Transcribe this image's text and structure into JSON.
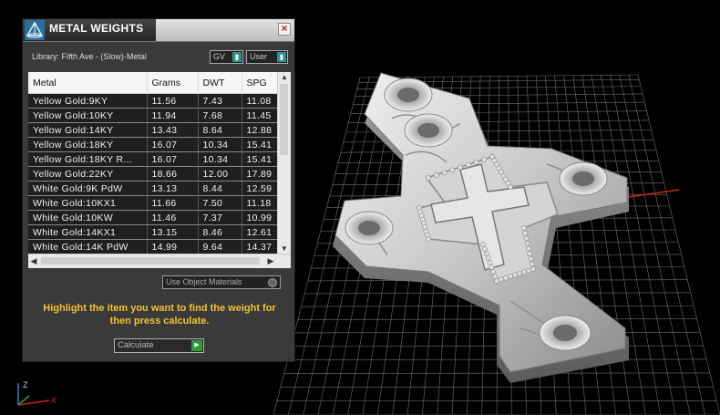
{
  "panel": {
    "title": "METAL WEIGHTS",
    "close_label": "×",
    "library_label": "Library: Fifth Ave - (Slow)-Metal",
    "gv_combo": "GV",
    "user_combo": "User",
    "combo_arrow": "▮",
    "use_object_materials": "Use Object Materials",
    "instruction": "Highlight the item you want to find the weight for then press calculate.",
    "calculate_label": "Calculate",
    "calculate_icon": "▶"
  },
  "table": {
    "columns": [
      "Metal",
      "Grams",
      "DWT",
      "SPG"
    ],
    "rows": [
      [
        "Yellow Gold:9KY",
        "11.56",
        "7.43",
        "11.08"
      ],
      [
        "Yellow Gold:10KY",
        "11.94",
        "7.68",
        "11.45"
      ],
      [
        "Yellow Gold:14KY",
        "13.43",
        "8.64",
        "12.88"
      ],
      [
        "Yellow Gold:18KY",
        "16.07",
        "10.34",
        "15.41"
      ],
      [
        "Yellow Gold:18KY R...",
        "16.07",
        "10.34",
        "15.41"
      ],
      [
        "Yellow Gold:22KY",
        "18.66",
        "12.00",
        "17.89"
      ],
      [
        "White Gold:9K PdW",
        "13.13",
        "8.44",
        "12.59"
      ],
      [
        "White Gold:10KX1",
        "11.66",
        "7.50",
        "11.18"
      ],
      [
        "White Gold:10KW",
        "11.46",
        "7.37",
        "10.99"
      ],
      [
        "White Gold:14KX1",
        "13.15",
        "8.46",
        "12.61"
      ],
      [
        "White Gold:14K PdW",
        "14.99",
        "9.64",
        "14.37"
      ]
    ]
  },
  "scroll": {
    "up": "▲",
    "down": "▼",
    "left": "◀",
    "right": "▶"
  },
  "axis": {
    "z": "Z",
    "x": "X"
  },
  "colors": {
    "accent": "#2f8f92",
    "instruction_text": "#f2c230",
    "calculate_go": "#2e9a3a",
    "grid_line": "#6f6f6f",
    "axis_red": "#cc2222"
  }
}
